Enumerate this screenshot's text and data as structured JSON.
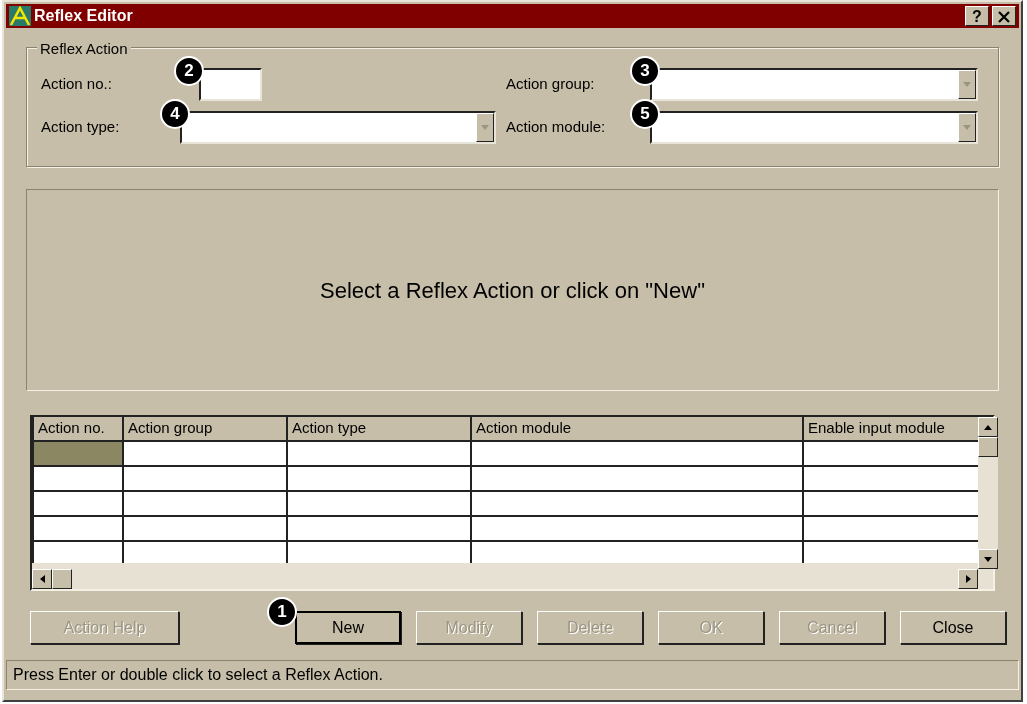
{
  "window": {
    "title": "Reflex Editor",
    "help_button": "?"
  },
  "group": {
    "title": "Reflex Action",
    "fields": [
      {
        "kind": "text",
        "label": "Action no.:",
        "callout": "2"
      },
      {
        "kind": "dropdown",
        "label": "Action group:",
        "callout": "3"
      },
      {
        "kind": "dropdown",
        "label": "Action type:",
        "callout": "4"
      },
      {
        "kind": "dropdown",
        "label": "Action module:",
        "callout": "5"
      }
    ]
  },
  "message": "Select a Reflex Action or click on \"New\"",
  "table": {
    "columns": [
      "Action no.",
      "Action group",
      "Action type",
      "Action module",
      "Enable input module"
    ],
    "rows": [
      {
        "selected": true
      },
      {
        "selected": false
      },
      {
        "selected": false
      },
      {
        "selected": false
      },
      {
        "selected": false
      }
    ]
  },
  "buttons": [
    {
      "label": "Action Help",
      "disabled": true
    },
    {
      "label": "New",
      "disabled": false,
      "callout": "1"
    },
    {
      "label": "Modify",
      "disabled": true
    },
    {
      "label": "Delete",
      "disabled": true
    },
    {
      "label": "OK",
      "disabled": true
    },
    {
      "label": "Cancel",
      "disabled": true
    },
    {
      "label": "Close",
      "disabled": false
    }
  ],
  "status_bar": "Press Enter or double click to select a Reflex Action."
}
